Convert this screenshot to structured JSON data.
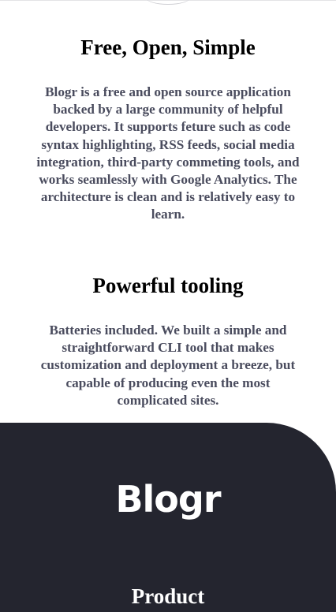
{
  "features": [
    {
      "title": "Free, Open, Simple",
      "body": "Blogr is a free and open source application backed by a large community of helpful developers. It supports feture such as code syntax highlighting, RSS feeds, social media integration, third-party commeting tools, and works seamlessly with Google Analytics. The architecture is clean and is relatively easy to learn."
    },
    {
      "title": "Powerful tooling",
      "body": "Batteries included. We built a simple and straightforward CLI tool that makes customization and deployment a breeze, but capable of producing even the most complicated sites."
    }
  ],
  "footer": {
    "logo": "Blogr",
    "column_heading": "Product",
    "background": "#24252f"
  },
  "colors": {
    "heading": "#000000",
    "body_text": "#4a4c5e",
    "footer_text": "#ffffff"
  }
}
